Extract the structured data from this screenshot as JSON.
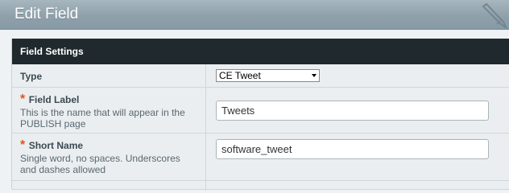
{
  "header": {
    "title": "Edit Field"
  },
  "panel": {
    "title": "Field Settings",
    "rows": [
      {
        "label": "Type",
        "required": false,
        "value": "CE Tweet"
      },
      {
        "label": "Field Label",
        "required": true,
        "hint": "This is the name that will appear in the PUBLISH page",
        "value": "Tweets"
      },
      {
        "label": "Short Name",
        "required": true,
        "hint": "Single word, no spaces. Underscores and dashes allowed",
        "value": "software_tweet"
      }
    ]
  },
  "icons": {
    "header_icon": "pencil-icon"
  },
  "colors": {
    "required_asterisk": "#e0551b",
    "panel_header_bg": "#20292e",
    "titlebar": "#8fa1ab"
  }
}
